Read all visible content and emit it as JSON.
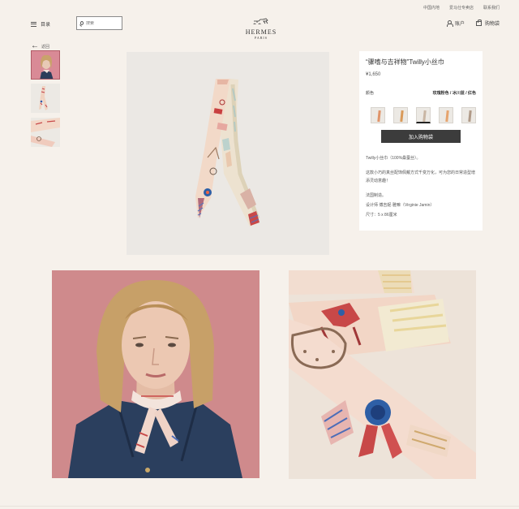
{
  "util_links": [
    "中国内地",
    "爱马仕专卖店",
    "联系我们"
  ],
  "header": {
    "menu_label": "目录",
    "search_placeholder": "搜索",
    "logo_brand": "HERMES",
    "logo_city": "PARIS",
    "account_label": "账户",
    "cart_label": "购物袋"
  },
  "back_label": "返回",
  "product": {
    "title": "“骤嗜与吉祥物”Twilly小丝巾",
    "price": "¥1,650",
    "color_label": "颜色",
    "color_value": "玫瑰粉色 / 冰川蓝 / 红色",
    "add_to_cart": "加入购物袋",
    "desc": {
      "material": "Twilly小丝巾（100%桑蚕丝）。",
      "pitch": "这款小巧的真丝配饰佩戴方式千变万化，可为您的日常造型增添灵动意趣！",
      "origin": "法国制造。",
      "designer": "设计师 傅吉妮·雅嘛（Virginie Jamin）",
      "size": "尺寸：5 x 86厘米"
    }
  },
  "swatches": [
    {
      "color": "#e0946a",
      "selected": false
    },
    {
      "color": "#d99a5a",
      "selected": false
    },
    {
      "color": "#c9b6a4",
      "selected": true
    },
    {
      "color": "#e6a46e",
      "selected": false
    },
    {
      "color": "#b09a88",
      "selected": false
    }
  ],
  "colors": {
    "background": "#f6f1eb",
    "button": "#3c3c3c",
    "main_image_bg": "#ebe8e4",
    "lower_left_bg": "#cf8a8c"
  }
}
